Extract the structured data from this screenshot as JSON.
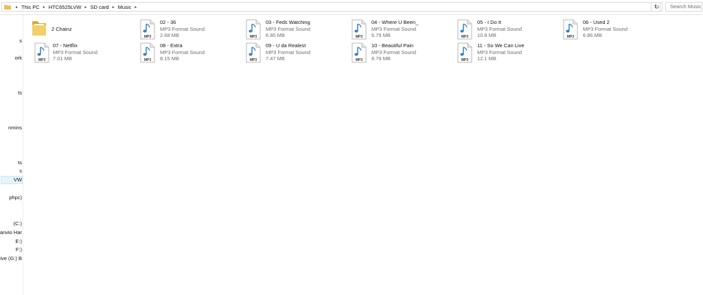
{
  "address": {
    "crumbs": [
      "This PC",
      "HTC6525LVW",
      "SD card",
      "Music"
    ]
  },
  "search": {
    "placeholder": "Search Music"
  },
  "nav_items": [
    "s",
    "ork",
    "ts",
    "nmins",
    "ts",
    "s",
    "VW",
    "phpc)",
    "(C:)",
    "anvio Har",
    "E:)",
    "F:)",
    "rive (G:) B"
  ],
  "files": [
    {
      "name": "2 Chainz",
      "type": "",
      "size": "",
      "kind": "folder"
    },
    {
      "name": "02 - 36",
      "type": "MP3 Format Sound",
      "size": "2.68 MB",
      "kind": "mp3"
    },
    {
      "name": "03 - Feds Watching",
      "type": "MP3 Format Sound",
      "size": "6.80 MB",
      "kind": "mp3"
    },
    {
      "name": "04 - Where U Been_",
      "type": "MP3 Format Sound",
      "size": "6.79 MB",
      "kind": "mp3"
    },
    {
      "name": "05 - I Do It",
      "type": "MP3 Format Sound",
      "size": "10.8 MB",
      "kind": "mp3"
    },
    {
      "name": "06 - Used 2",
      "type": "MP3 Format Sound",
      "size": "6.86 MB",
      "kind": "mp3"
    },
    {
      "name": "07 - Netflix",
      "type": "MP3 Format Sound",
      "size": "7.01 MB",
      "kind": "mp3"
    },
    {
      "name": "08 - Extra",
      "type": "MP3 Format Sound",
      "size": "8.15 MB",
      "kind": "mp3"
    },
    {
      "name": "09 - U da Realest",
      "type": "MP3 Format Sound",
      "size": "7.47 MB",
      "kind": "mp3"
    },
    {
      "name": "10 - Beautiful Pain",
      "type": "MP3 Format Sound",
      "size": "8.79 MB",
      "kind": "mp3"
    },
    {
      "name": "11 - So We Can Live",
      "type": "MP3 Format Sound",
      "size": "12.1 MB",
      "kind": "mp3"
    }
  ],
  "icon_label": "MP3",
  "colors": {
    "folder": "#e8c15a",
    "note": "#2f7fc6",
    "selected": "#e5f3fb"
  }
}
